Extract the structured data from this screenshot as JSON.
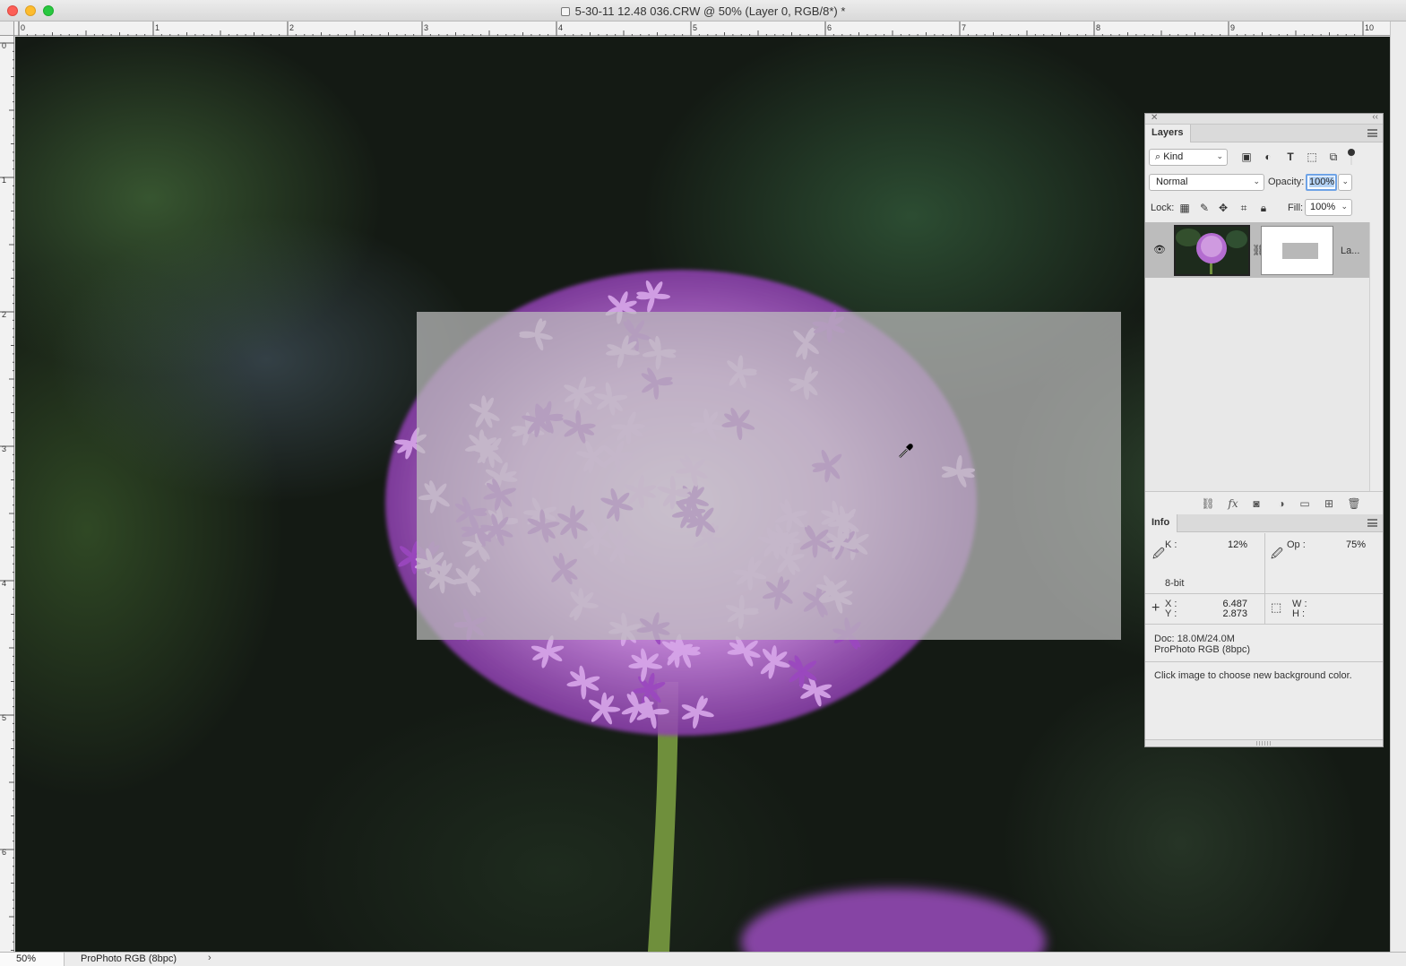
{
  "window": {
    "title": "5-30-11 12.48 036.CRW @ 50% (Layer 0, RGB/8*) *"
  },
  "rulers": {
    "horizontal_labels": [
      "0",
      "1",
      "2",
      "3",
      "4",
      "5",
      "6",
      "7",
      "8",
      "9",
      "10"
    ],
    "vertical_labels": [
      "0",
      "1",
      "2",
      "3",
      "4",
      "5",
      "6"
    ]
  },
  "statusbar": {
    "zoom": "50%",
    "profile": "ProPhoto RGB (8bpc)",
    "arrow": "›"
  },
  "layers_panel": {
    "tab_label": "Layers",
    "filter_kind": "Kind",
    "blend_mode": "Normal",
    "opacity_label": "Opacity:",
    "opacity_value": "100%",
    "lock_label": "Lock:",
    "fill_label": "Fill:",
    "fill_value": "100%",
    "layers": [
      {
        "name": "La...",
        "visible": true
      }
    ]
  },
  "info_panel": {
    "tab_label": "Info",
    "k_label": "K :",
    "k_value": "12%",
    "op_label": "Op :",
    "op_value": "75%",
    "bit_depth": "8-bit",
    "x_label": "X :",
    "x_value": "6.487",
    "y_label": "Y :",
    "y_value": "2.873",
    "w_label": "W :",
    "h_label": "H :",
    "doc_size": "Doc: 18.0M/24.0M",
    "color_profile": "ProPhoto RGB (8bpc)",
    "hint": "Click image to choose new background color."
  },
  "colors": {
    "overlay_gray": "#bebebe",
    "flower_purple": "#c58ad8",
    "selection_blue": "#6ea3e6"
  }
}
